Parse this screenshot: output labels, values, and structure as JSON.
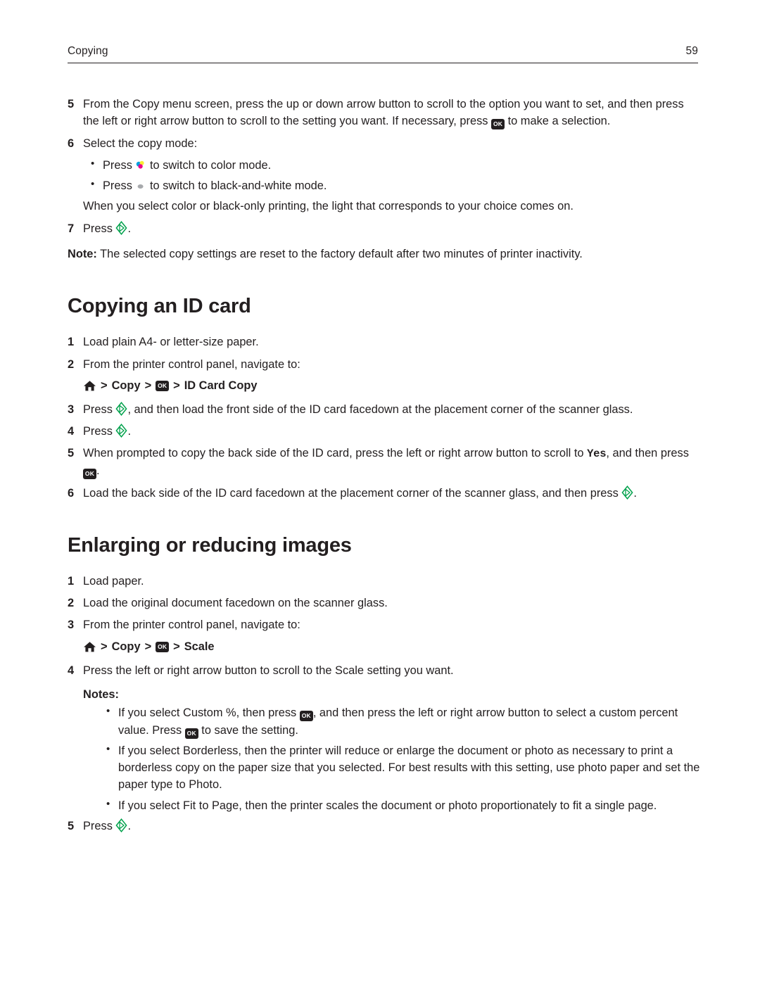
{
  "header": {
    "title": "Copying",
    "page_number": "59"
  },
  "sections": [
    {
      "id": "copy-steps",
      "steps": [
        {
          "num": "5",
          "text_before": "From the Copy menu screen, press the up or down arrow button to scroll to the option you want to set, and then press the left or right arrow button to scroll to the setting you want. If necessary, press ",
          "icon": "ok-button-icon",
          "text_after": " to make a selection."
        },
        {
          "num": "6",
          "text_before": "Select the copy mode:",
          "icon": "",
          "text_after": ""
        }
      ],
      "bullets": [
        {
          "before": "Press ",
          "icon": "color-mode-icon",
          "after": " to switch to color mode."
        },
        {
          "before": "Press ",
          "icon": "black-and-white-mode-icon",
          "after": "  to switch to black-and-white mode."
        }
      ],
      "paragraph": "When you select color or black-only printing, the light that corresponds to your choice comes on.",
      "step7": {
        "num": "7",
        "before": "Press ",
        "icon": "start-button-icon",
        "after": "."
      },
      "note_label": "Note:",
      "note_text": " The selected copy settings are reset to the factory default after two minutes of printer inactivity."
    },
    {
      "id": "copying-an-id-card",
      "heading": "Copying an ID card",
      "steps": [
        {
          "num": "1",
          "before": "Load plain A4- or letter-size paper.",
          "icon": "",
          "after": ""
        },
        {
          "num": "2",
          "before": "From the printer control panel, navigate to:",
          "icon": "",
          "after": ""
        }
      ],
      "nav": {
        "home_icon": "home-icon",
        "sep1": ">",
        "copy_label": "Copy",
        "sep2": ">",
        "ok_icon": "ok-button-icon",
        "sep3": ">",
        "target_label": "ID Card Copy"
      },
      "steps2": [
        {
          "num": "3",
          "before": "Press ",
          "icon": "start-button-icon",
          "after": ", and then load the front side of the ID card facedown at the placement corner of the scanner glass."
        },
        {
          "num": "4",
          "before": "Press ",
          "icon": "start-button-icon",
          "after": "."
        },
        {
          "num": "5",
          "before": "When prompted to copy the back side of the ID card, press the left or right arrow button to scroll to ",
          "mono": "Yes",
          "mid": ", and then press ",
          "icon": "ok-button-icon",
          "after": "."
        },
        {
          "num": "6",
          "before": "Load the back side of the ID card facedown at the placement corner of the scanner glass, and then press ",
          "icon": "start-button-icon",
          "after": "."
        }
      ]
    },
    {
      "id": "enlarging-or-reducing-images",
      "heading": "Enlarging or reducing images",
      "steps": [
        {
          "num": "1",
          "text": "Load paper."
        },
        {
          "num": "2",
          "text": "Load the original document facedown on the scanner glass."
        },
        {
          "num": "3",
          "text": "From the printer control panel, navigate to:"
        }
      ],
      "nav": {
        "home_icon": "home-icon",
        "sep1": ">",
        "copy_label": "Copy",
        "sep2": ">",
        "ok_icon": "ok-button-icon",
        "sep3": ">",
        "target_label": "Scale"
      },
      "step4": {
        "num": "4",
        "text": "Press the left or right arrow button to scroll to the Scale setting you want."
      },
      "notes_label": "Notes:",
      "notes": [
        {
          "before": "If you select Custom %, then press ",
          "icon": "ok-button-icon",
          "mid": ", and then press the left or right arrow button to select a custom percent value. Press ",
          "icon2": "ok-button-icon",
          "after": " to save the setting."
        },
        {
          "before": "If you select Borderless, then the printer will reduce or enlarge the document or photo as necessary to print a borderless copy on the paper size that you selected. For best results with this setting, use photo paper and set the paper type to Photo."
        },
        {
          "before": "If you select Fit to Page, then the printer scales the document or photo proportionately to fit a single page."
        }
      ],
      "step5": {
        "num": "5",
        "before": "Press ",
        "icon": "start-button-icon",
        "after": "."
      }
    }
  ],
  "colors": {
    "text": "#231f20",
    "start_green": "#00a14b",
    "rule": "#231f20"
  }
}
